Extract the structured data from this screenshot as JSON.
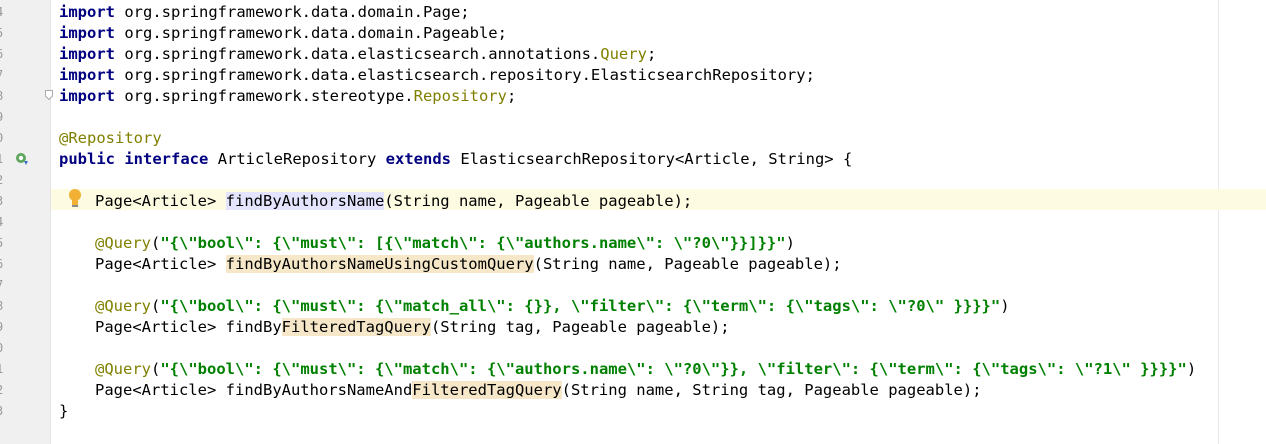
{
  "gutter": {
    "line_numbers": [
      "4",
      "5",
      "6",
      "7",
      "8",
      "9",
      "0",
      "1",
      "2",
      "3",
      "4",
      "5",
      "6",
      "7",
      "8",
      "9",
      "0",
      "1",
      "2",
      "3"
    ]
  },
  "code": {
    "imports": [
      {
        "kw": "import",
        "pkg": "org.springframework.data.domain.Page;"
      },
      {
        "kw": "import",
        "pkg": "org.springframework.data.domain.Pageable;"
      },
      {
        "kw": "import",
        "pkg": "org.springframework.data.elasticsearch.annotations.",
        "cls": "Query",
        ";": ";"
      },
      {
        "kw": "import",
        "pkg": "org.springframework.data.elasticsearch.repository.ElasticsearchRepository;"
      },
      {
        "kw": "import",
        "pkg": "org.springframework.stereotype.",
        "cls": "Repository"
      }
    ],
    "class_annotation": "@Repository",
    "class_decl": {
      "public_kw": "public",
      "interface_kw": "interface",
      "name": "ArticleRepository",
      "extends_kw": "extends",
      "base": "ElasticsearchRepository<Article, String> {"
    },
    "methods": [
      {
        "ret": "Page<Article> ",
        "name": "findByAuthorsName",
        "params": "(String name, Pageable pageable);"
      },
      {
        "annotation": "@Query",
        "query": "\"{\\\"bool\\\": {\\\"must\\\": [{\\\"match\\\": {\\\"authors.name\\\": \\\"?0\\\"}}]}}\"",
        "ret": "Page<Article> ",
        "name": "findByAuthorsNameUsingCustomQuery",
        "params": "(String name, Pageable pageable);"
      },
      {
        "annotation": "@Query",
        "query": "\"{\\\"bool\\\": {\\\"must\\\": {\\\"match_all\\\": {}}, \\\"filter\\\": {\\\"term\\\": {\\\"tags\\\": \\\"?0\\\" }}}}\"",
        "ret": "Page<Article> ",
        "name_a": "findBy",
        "name_b": "FilteredTagQuery",
        "params": "(String tag, Pageable pageable);"
      },
      {
        "annotation": "@Query",
        "query": "\"{\\\"bool\\\": {\\\"must\\\": {\\\"match\\\": {\\\"authors.name\\\": \\\"?0\\\"}}, \\\"filter\\\": {\\\"term\\\": {\\\"tags\\\": \\\"?1\\\" }}}}\"",
        "ret": "Page<Article> ",
        "name_a": "findByAuthorsNameAnd",
        "name_b": "FilteredTagQuery",
        "params": "(String name, String tag, Pageable pageable);"
      }
    ],
    "closing_brace": "}"
  },
  "icons": [
    "intention-bulb-icon",
    "implemented-interface-icon",
    "fold-marker-icon"
  ],
  "colors": {
    "keyword": "#000080",
    "annotation": "#808000",
    "string": "#008000",
    "caret_line": "#fdfce3"
  }
}
